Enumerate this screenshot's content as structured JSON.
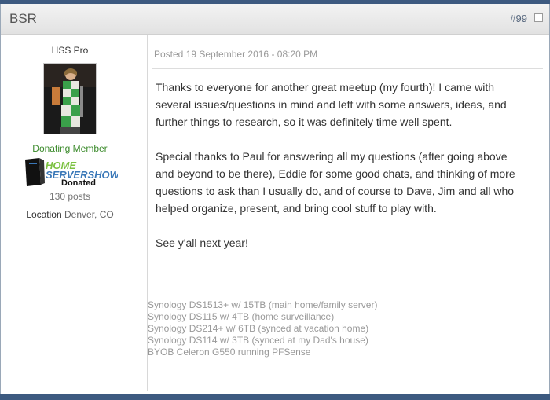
{
  "header": {
    "author": "BSR",
    "post_number": "#99"
  },
  "sidebar": {
    "user_title": "HSS Pro",
    "member_title": "Donating Member",
    "badge": {
      "line1": "HOME",
      "line2": "SERVERSHOW",
      "line3": "Donated"
    },
    "posts": "130 posts",
    "location_label": "Location",
    "location_value": "Denver, CO"
  },
  "post": {
    "posted": "Posted 19 September 2016 - 08:20 PM",
    "paragraphs": [
      "Thanks to everyone for another great meetup (my fourth)!  I came with several issues/questions in mind and left with some answers, ideas, and further things to research, so it was definitely time well spent.",
      "Special thanks to Paul for answering all my questions (after going above and beyond to be there), Eddie for some good chats, and thinking of more questions to ask than I usually do, and of course to Dave, Jim and all who helped organize, present, and bring cool stuff to play with.",
      "See y'all next year!"
    ]
  },
  "signature": [
    "Synology DS1513+ w/ 15TB (main home/family server)",
    "Synology DS115 w/ 4TB (home surveillance)",
    "Synology DS214+ w/ 6TB (synced at vacation home)",
    "Synology DS114 w/ 3TB (synced at my Dad's house)",
    "BYOB Celeron G550 running PFSense"
  ],
  "colors": {
    "page_bg": "#3d5a80",
    "member_title": "#3a8a2a",
    "badge_green": "#7cc242",
    "badge_blue": "#3a78b8"
  }
}
